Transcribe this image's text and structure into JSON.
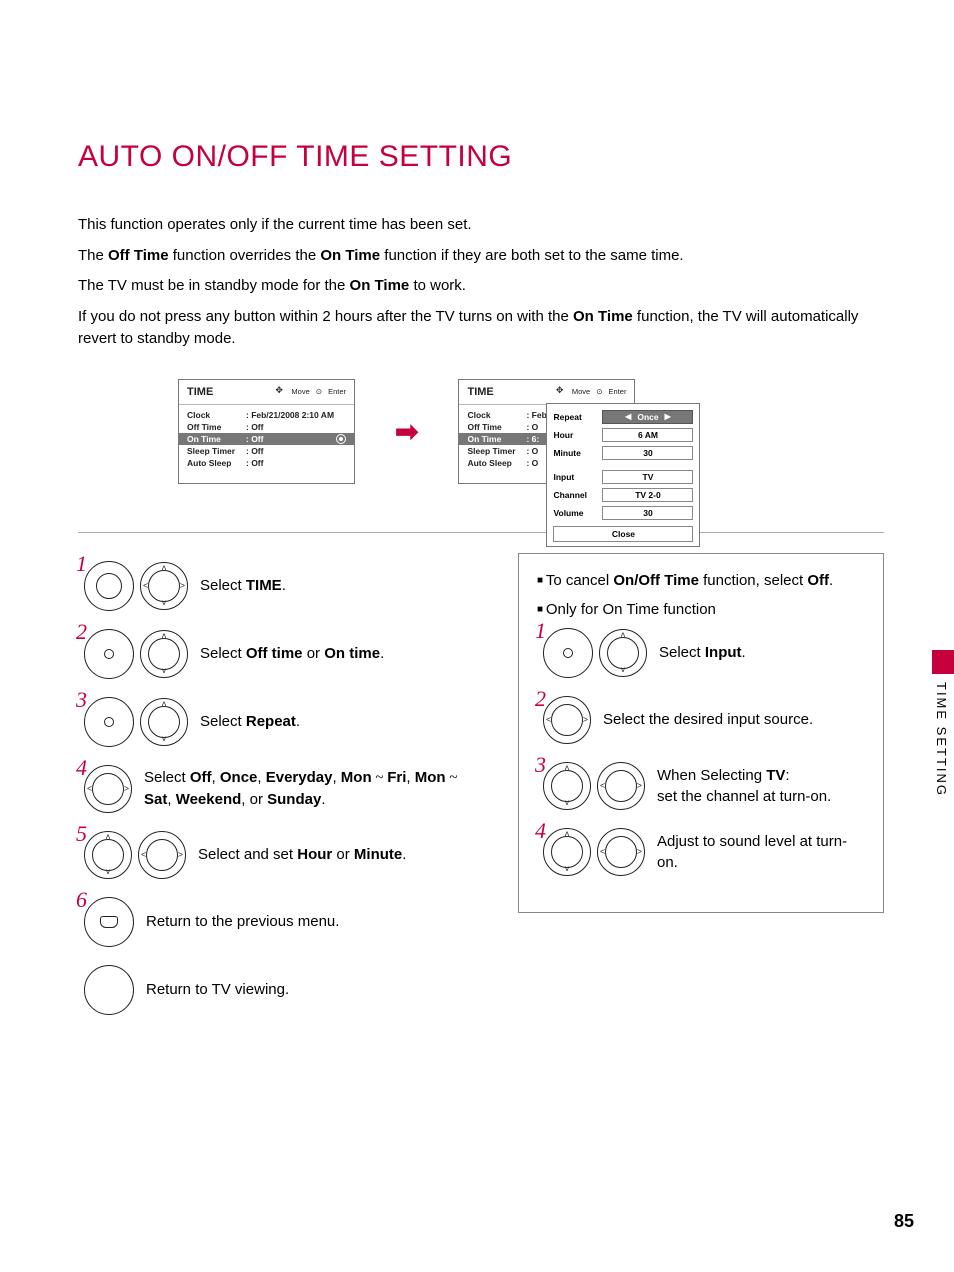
{
  "title": "AUTO ON/OFF TIME SETTING",
  "intro": {
    "l1": "This function operates only if the current time has been set.",
    "l2a": "The ",
    "l2b": "Off Time",
    "l2c": " function overrides the ",
    "l2d": "On Time",
    "l2e": " function if they are both set to the same time.",
    "l3a": "The TV must be in standby mode for the ",
    "l3b": "On Time",
    "l3c": " to work.",
    "l4a": "If you do not press any button within 2 hours after the TV turns on with the ",
    "l4b": "On Time",
    "l4c": " function, the TV will automatically revert to standby mode."
  },
  "osd": {
    "title": "TIME",
    "hint_move": "Move",
    "hint_enter": "Enter",
    "rows": {
      "clock_l": "Clock",
      "clock_v": ": Feb/21/2008  2:10 AM",
      "off_l": "Off Time",
      "off_v": ": Off",
      "on_l": "On Time",
      "on_v": ": Off",
      "on_v2": ": 6:",
      "sleep_l": "Sleep Timer",
      "sleep_v": ": Off",
      "auto_l": "Auto Sleep",
      "auto_v": ": Off",
      "off_v2": ": O",
      "sleep_v2": ": O",
      "auto_v2": ": O"
    }
  },
  "popup": {
    "repeat_l": "Repeat",
    "repeat_v": "Once",
    "hour_l": "Hour",
    "hour_v": "6 AM",
    "minute_l": "Minute",
    "minute_v": "30",
    "input_l": "Input",
    "input_v": "TV",
    "channel_l": "Channel",
    "channel_v": "TV 2-0",
    "volume_l": "Volume",
    "volume_v": "30",
    "close": "Close"
  },
  "stepsL": {
    "n1": "1",
    "t1a": "Select ",
    "t1b": "TIME",
    "t1c": ".",
    "n2": "2",
    "t2a": "Select ",
    "t2b": "Off time",
    "t2c": " or ",
    "t2d": "On time",
    "t2e": ".",
    "n3": "3",
    "t3a": "Select ",
    "t3b": "Repeat",
    "t3c": ".",
    "n4": "4",
    "t4a": "Select ",
    "t4b": "Off",
    "t4c": ", ",
    "t4d": "Once",
    "t4e": ", ",
    "t4f": "Everyday",
    "t4g": ", ",
    "t4h": "Mon",
    "t4sp1": " ~ ",
    "t4i": "Fri",
    "t4j": ", ",
    "t4k": "Mon",
    "t4sp2": " ~ ",
    "t4l": "Sat",
    "t4m": ", ",
    "t4n": "Weekend",
    "t4o": ", or ",
    "t4p": "Sunday",
    "t4q": ".",
    "n5": "5",
    "t5a": "Select and set ",
    "t5b": "Hour",
    "t5c": " or ",
    "t5d": "Minute",
    "t5e": ".",
    "n6": "6",
    "t6": "Return to the previous menu.",
    "t7": "Return to TV viewing."
  },
  "stepsR": {
    "note1a": "To cancel ",
    "note1b": "On/Off Time",
    "note1c": " function, select ",
    "note1d": "Off",
    "note1e": ".",
    "note2": "Only for On Time function",
    "n1": "1",
    "t1a": "Select ",
    "t1b": "Input",
    "t1c": ".",
    "n2": "2",
    "t2": "Select the desired input source.",
    "n3": "3",
    "t3a": "When Selecting ",
    "t3b": "TV",
    "t3c": ":",
    "t3d": "set the channel at turn-on.",
    "n4": "4",
    "t4": "Adjust to sound level at turn-on."
  },
  "side": "TIME SETTING",
  "pagenum": "85"
}
